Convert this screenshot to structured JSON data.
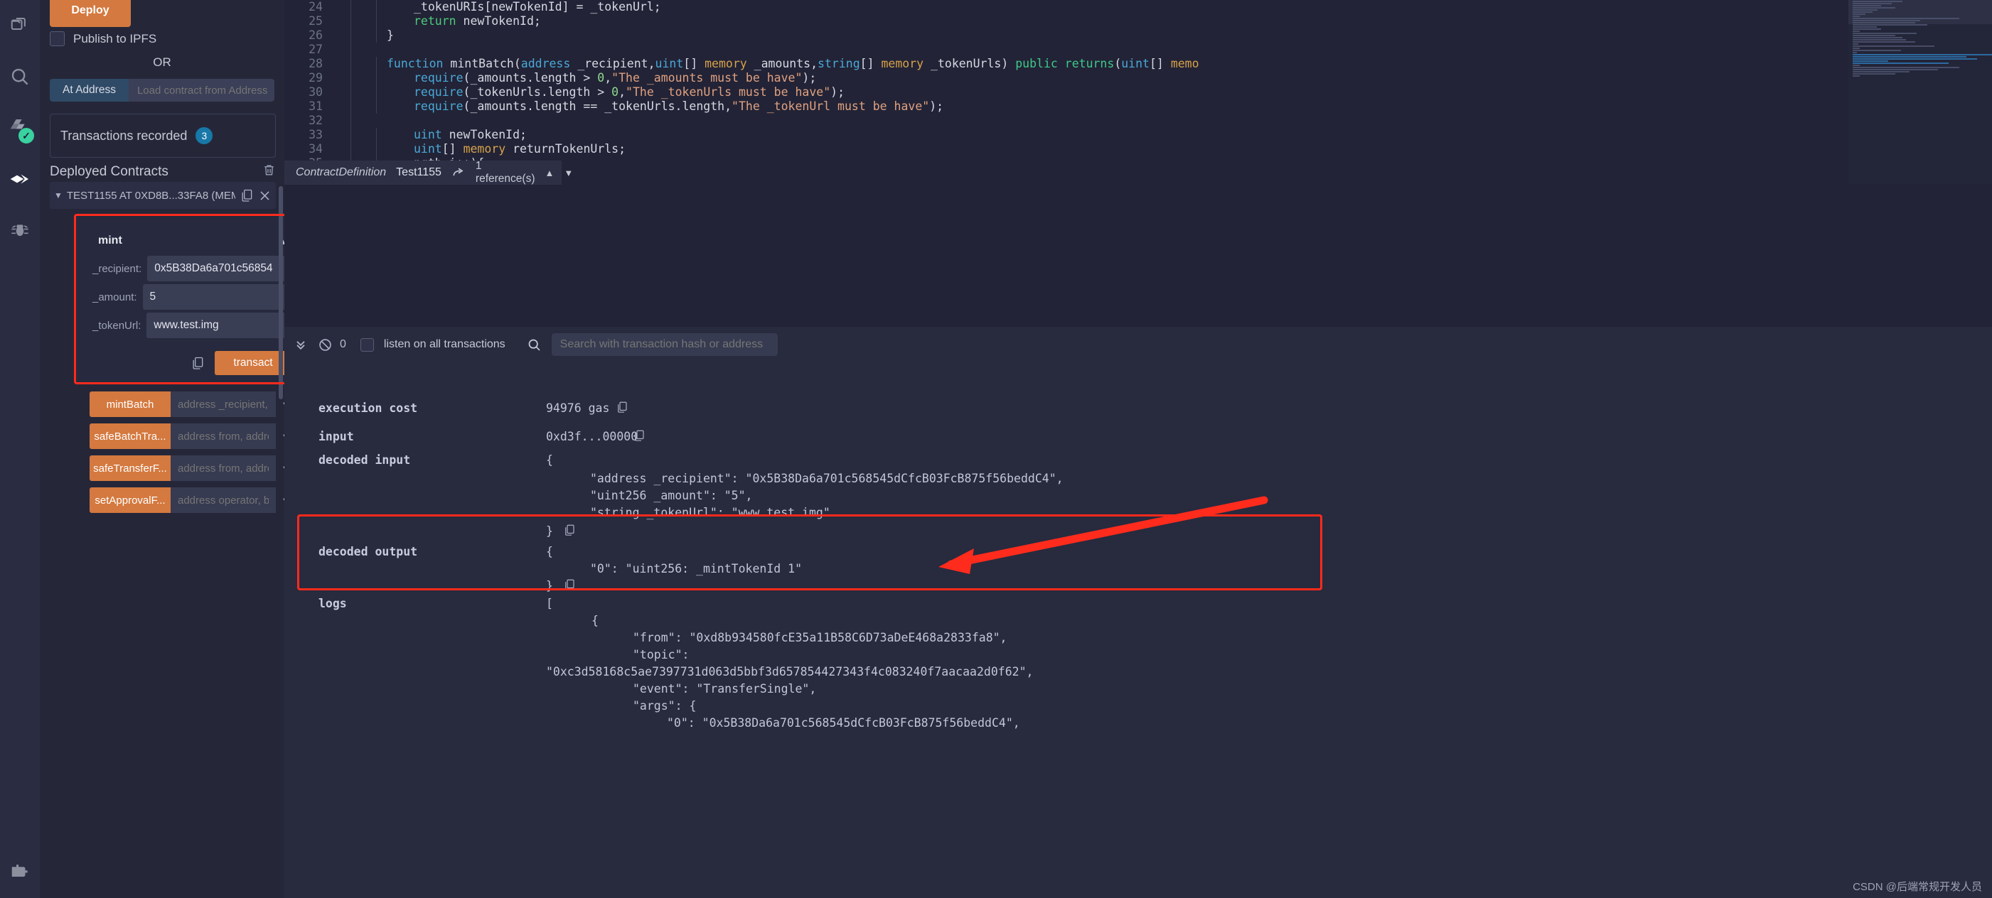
{
  "app": {
    "name": "Remix IDE",
    "accent_orange": "#d4793f",
    "highlight_red": "#ff2b1c",
    "badge_blue": "#1878a8",
    "ok_green": "#3ad29f"
  },
  "icon_rail": {
    "items": [
      {
        "name": "file-explorer-icon",
        "label": "File explorer"
      },
      {
        "name": "search-icon",
        "label": "Search in files"
      },
      {
        "name": "solidity-compiler-icon",
        "label": "Solidity compiler",
        "badge": "check"
      },
      {
        "name": "deploy-run-icon",
        "label": "Deploy & run transactions",
        "active": true
      },
      {
        "name": "debugger-icon",
        "label": "Debugger"
      },
      {
        "name": "plugin-manager-icon",
        "label": "Plugin manager"
      }
    ]
  },
  "deploy_panel": {
    "deploy_button": "Deploy",
    "publish_ipfs_label": "Publish to IPFS",
    "publish_ipfs_checked": false,
    "or_label": "OR",
    "at_address_button": "At Address",
    "at_address_placeholder": "Load contract from Address",
    "at_address_value": "",
    "transactions_recorded_label": "Transactions recorded",
    "transactions_recorded_count": "3",
    "deployed_contracts_title": "Deployed Contracts",
    "contract": {
      "label": "TEST1155 AT 0XD8B...33FA8 (MEM",
      "copy_icon": "copy-icon",
      "close_icon": "close-icon"
    },
    "mint": {
      "title": "mint",
      "collapsed": false,
      "params": [
        {
          "label": "_recipient:",
          "value": "0x5B38Da6a701c56854"
        },
        {
          "label": "_amount:",
          "value": "5"
        },
        {
          "label": "_tokenUrl:",
          "value": "www.test.img"
        }
      ],
      "transact_button": "transact",
      "copy_calldata_icon": "copy-icon"
    },
    "functions": [
      {
        "name": "mintBatch",
        "placeholder": "address _recipient, uin"
      },
      {
        "name": "safeBatchTra...",
        "placeholder": "address from, address"
      },
      {
        "name": "safeTransferF...",
        "placeholder": "address from, address"
      },
      {
        "name": "setApprovalF...",
        "placeholder": "address operator, bool"
      }
    ]
  },
  "editor": {
    "lines": [
      {
        "n": "24",
        "indent": 2,
        "tokens": [
          {
            "t": "_tokenURIs[newTokenId] = _tokenUrl;",
            "c": "k-plain"
          }
        ]
      },
      {
        "n": "25",
        "indent": 2,
        "tokens": [
          {
            "t": "return",
            "c": "k-ret"
          },
          {
            "t": " newTokenId;",
            "c": "k-plain"
          }
        ]
      },
      {
        "n": "26",
        "indent": 1,
        "tokens": [
          {
            "t": "}",
            "c": "k-plain"
          }
        ]
      },
      {
        "n": "27",
        "indent": 0,
        "tokens": []
      },
      {
        "n": "28",
        "indent": 1,
        "tokens": [
          {
            "t": "function",
            "c": "k-fn"
          },
          {
            "t": " mintBatch(",
            "c": "k-plain"
          },
          {
            "t": "address",
            "c": "k-type"
          },
          {
            "t": " _recipient,",
            "c": "k-plain"
          },
          {
            "t": "uint",
            "c": "k-type"
          },
          {
            "t": "[] ",
            "c": "k-plain"
          },
          {
            "t": "memory",
            "c": "k-mem"
          },
          {
            "t": " _amounts,",
            "c": "k-plain"
          },
          {
            "t": "string",
            "c": "k-type"
          },
          {
            "t": "[] ",
            "c": "k-plain"
          },
          {
            "t": "memory",
            "c": "k-mem"
          },
          {
            "t": " _tokenUrls) ",
            "c": "k-plain"
          },
          {
            "t": "public",
            "c": "k-pub"
          },
          {
            "t": " ",
            "c": "k-plain"
          },
          {
            "t": "returns",
            "c": "k-pub"
          },
          {
            "t": "(",
            "c": "k-plain"
          },
          {
            "t": "uint",
            "c": "k-type"
          },
          {
            "t": "[] ",
            "c": "k-plain"
          },
          {
            "t": "memo",
            "c": "k-mem"
          }
        ]
      },
      {
        "n": "29",
        "indent": 2,
        "tokens": [
          {
            "t": "require",
            "c": "k-fn"
          },
          {
            "t": "(_amounts.length > ",
            "c": "k-plain"
          },
          {
            "t": "0",
            "c": "k-num"
          },
          {
            "t": ",",
            "c": "k-plain"
          },
          {
            "t": "\"The _amounts must be have\"",
            "c": "k-str"
          },
          {
            "t": ");",
            "c": "k-plain"
          }
        ]
      },
      {
        "n": "30",
        "indent": 2,
        "tokens": [
          {
            "t": "require",
            "c": "k-fn"
          },
          {
            "t": "(_tokenUrls.length > ",
            "c": "k-plain"
          },
          {
            "t": "0",
            "c": "k-num"
          },
          {
            "t": ",",
            "c": "k-plain"
          },
          {
            "t": "\"The _tokenUrls must be have\"",
            "c": "k-str"
          },
          {
            "t": ");",
            "c": "k-plain"
          }
        ]
      },
      {
        "n": "31",
        "indent": 2,
        "tokens": [
          {
            "t": "require",
            "c": "k-fn"
          },
          {
            "t": "(_amounts.length == _tokenUrls.length,",
            "c": "k-plain"
          },
          {
            "t": "\"The _tokenUrl must be have\"",
            "c": "k-str"
          },
          {
            "t": ");",
            "c": "k-plain"
          }
        ]
      },
      {
        "n": "32",
        "indent": 0,
        "tokens": []
      },
      {
        "n": "33",
        "indent": 2,
        "tokens": [
          {
            "t": "uint",
            "c": "k-type"
          },
          {
            "t": " newTokenId;",
            "c": "k-plain"
          }
        ]
      },
      {
        "n": "34",
        "indent": 2,
        "tokens": [
          {
            "t": "uint",
            "c": "k-type"
          },
          {
            "t": "[] ",
            "c": "k-plain"
          },
          {
            "t": "memory",
            "c": "k-mem"
          },
          {
            "t": " returnTokenUrls;",
            "c": "k-plain"
          }
        ]
      },
      {
        "n": "35",
        "indent": 2,
        "tokens": [
          {
            "t": "ngth;i++){",
            "c": "k-plain"
          }
        ]
      }
    ],
    "contract_definition": {
      "kind": "ContractDefinition",
      "name": "Test1155",
      "goto_icon": "go-to-definition-icon",
      "references": "1 reference(s)",
      "prev_icon": "chevron-up-icon",
      "next_icon": "chevron-down-icon"
    }
  },
  "terminal": {
    "toolbar": {
      "collapse_icon": "double-chevron-down-icon",
      "clear_icon": "clear-console-icon",
      "pending_count": "0",
      "listen_label": "listen on all transactions",
      "listen_checked": false,
      "search_icon": "search-icon",
      "search_placeholder": "Search with transaction hash or address",
      "search_value": ""
    },
    "details": [
      {
        "key": "execution cost",
        "value": "94976 gas",
        "copy": true
      },
      {
        "key": "input",
        "value": "0xd3f...00000",
        "copy": true
      },
      {
        "key": "decoded input",
        "value": "{",
        "copy": false
      }
    ],
    "decoded_input_lines": [
      "\"address _recipient\": \"0x5B38Da6a701c568545dCfcB03FcB875f56beddC4\",",
      "\"uint256 _amount\": \"5\",",
      "\"string _tokenUrl\": \"www.test.img\""
    ],
    "decoded_input_close": "}",
    "decoded_output": {
      "key": "decoded output",
      "open": "{",
      "lines": [
        "\"0\": \"uint256: _mintTokenId 1\""
      ],
      "close": "}"
    },
    "logs": {
      "key": "logs",
      "open": "[",
      "lines": [
        "{",
        "\"from\": \"0xd8b934580fcE35a11B58C6D73aDeE468a2833fa8\",",
        "\"topic\":",
        "\"0xc3d58168c5ae7397731d063d5bbf3d657854427343f4c083240f7aacaa2d0f62\",",
        "\"event\": \"TransferSingle\",",
        "\"args\": {",
        "\"0\": \"0x5B38Da6a701c568545dCfcB03FcB875f56beddC4\","
      ]
    }
  },
  "watermark": "CSDN @后端常规开发人员"
}
